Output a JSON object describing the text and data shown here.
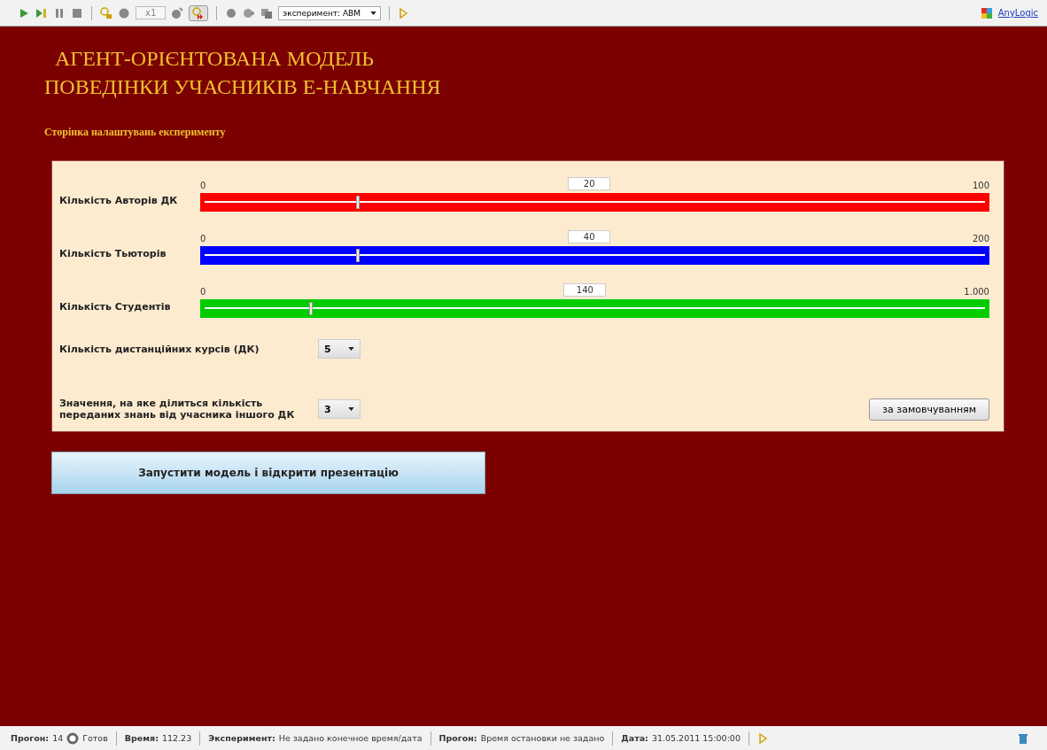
{
  "toolbar": {
    "speed": "x1",
    "fast_mode": {
      "selected": true
    },
    "experiment": "эксперимент: ABM",
    "logo_link": "AnyLogic"
  },
  "title_lines": [
    "АГЕНТ-ОРІЄНТОВАНА МОДЕЛЬ",
    "ПОВЕДІНКИ УЧАСНИКІВ Е-НАВЧАННЯ"
  ],
  "subtitle": "Сторінка налаштувань експерименту",
  "sliders": [
    {
      "label": "Кількість Авторів ДК",
      "min": "0",
      "max": "100",
      "value": "20",
      "level": 0.2,
      "color": "#ff0000"
    },
    {
      "label": "Кількість Тьюторів",
      "min": "0",
      "max": "200",
      "value": "40",
      "level": 0.2,
      "color": "#0000ff"
    },
    {
      "label": "Кількість Студентів",
      "min": "0",
      "max": "1.000",
      "value": "140",
      "level": 0.14,
      "color": "#00cc00"
    }
  ],
  "dropdowns": [
    {
      "label": "Кількість дистанційних курсів (ДК)",
      "value": "5"
    },
    {
      "label": "Значення, на яке ділиться кількість переданих знань від учасника іншого ДК",
      "value": "3"
    }
  ],
  "defaults_button": "за замовчуванням",
  "run_button": "Запустити модель і відкрити презентацію",
  "status_bar": [
    {
      "label": "Прогон:",
      "value": "14",
      "state": "Готов"
    },
    {
      "label": "Время:",
      "value": "112.23"
    },
    {
      "label": "Эксперимент:",
      "value": "Не задано конечное время/дата"
    },
    {
      "label": "Прогон:",
      "value": "Время остановки не задано"
    },
    {
      "label": "Дата:",
      "value": "31.05.2011 15:00:00"
    }
  ]
}
